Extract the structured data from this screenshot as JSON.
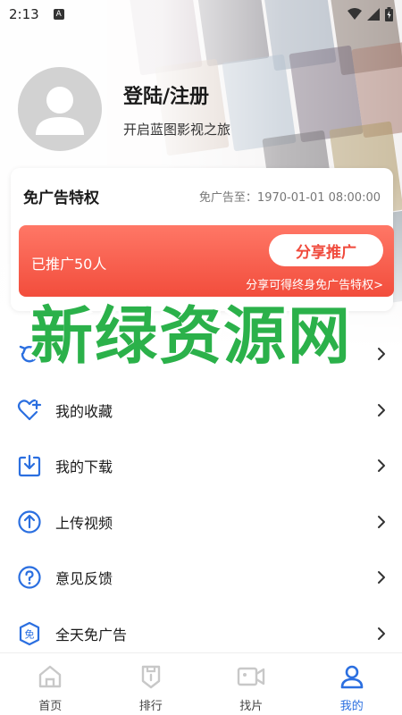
{
  "status_bar": {
    "time": "2:13",
    "notification_letter": "A"
  },
  "profile": {
    "title": "登陆/注册",
    "subtitle": "开启蓝图影视之旅"
  },
  "ad_card": {
    "title": "免广告特权",
    "expire_text": "免广告至：1970-01-01 08:00:00",
    "promo_count": "已推广50人",
    "share_button": "分享推广",
    "promo_tip": "分享可得终身免广告特权>"
  },
  "watermark": "新绿资源网",
  "menu": {
    "items": [
      {
        "label": "",
        "icon": "history-icon"
      },
      {
        "label": "我的收藏",
        "icon": "heart-plus-icon"
      },
      {
        "label": "我的下载",
        "icon": "download-icon"
      },
      {
        "label": "上传视频",
        "icon": "upload-icon"
      },
      {
        "label": "意见反馈",
        "icon": "help-icon"
      },
      {
        "label": "全天免广告",
        "icon": "ad-free-icon"
      }
    ]
  },
  "bottom_nav": {
    "items": [
      {
        "label": "首页",
        "icon": "home-icon",
        "active": false
      },
      {
        "label": "排行",
        "icon": "ranking-icon",
        "active": false
      },
      {
        "label": "找片",
        "icon": "video-icon",
        "active": false
      },
      {
        "label": "我的",
        "icon": "user-icon",
        "active": true
      }
    ]
  },
  "colors": {
    "accent_blue": "#2b6fe0",
    "promo_red": "#f24d3c",
    "watermark_green": "#2bb14a"
  }
}
